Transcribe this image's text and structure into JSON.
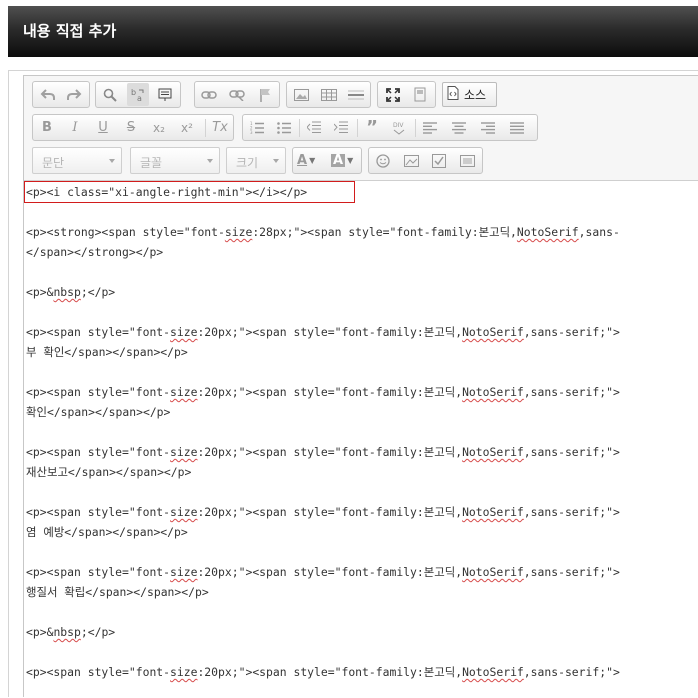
{
  "header": {
    "title": "내용 직접 추가"
  },
  "toolbar": {
    "row1": [
      {
        "name": "undo-button",
        "icon": "undo-icon"
      },
      {
        "name": "redo-button",
        "icon": "redo-icon"
      },
      {
        "name": "find-button",
        "icon": "search-icon"
      },
      {
        "name": "replace-button",
        "icon": "replace-icon"
      },
      {
        "name": "select-all-button",
        "icon": "select-all-icon"
      },
      {
        "name": "link-button",
        "icon": "link-icon"
      },
      {
        "name": "unlink-button",
        "icon": "unlink-icon"
      },
      {
        "name": "anchor-button",
        "icon": "flag-icon"
      },
      {
        "name": "image-button",
        "icon": "image-icon"
      },
      {
        "name": "table-button",
        "icon": "table-icon"
      },
      {
        "name": "horizontal-rule-button",
        "icon": "horizontal-rule-icon"
      },
      {
        "name": "maximize-button",
        "icon": "maximize-icon"
      },
      {
        "name": "show-blocks-button",
        "icon": "show-blocks-icon"
      }
    ],
    "source_label": "소스",
    "row2": [
      {
        "name": "bold-button",
        "glyph": "B"
      },
      {
        "name": "italic-button",
        "glyph": "I"
      },
      {
        "name": "underline-button",
        "glyph": "U"
      },
      {
        "name": "strike-button",
        "glyph": "S"
      },
      {
        "name": "subscript-button",
        "glyph": "x₂"
      },
      {
        "name": "superscript-button",
        "glyph": "x²"
      },
      {
        "name": "remove-format-button",
        "glyph": "Tx"
      }
    ],
    "row2b": [
      {
        "name": "numbered-list-button",
        "icon": "numbered-list-icon"
      },
      {
        "name": "bulleted-list-button",
        "icon": "bulleted-list-icon"
      },
      {
        "name": "outdent-button",
        "icon": "outdent-icon"
      },
      {
        "name": "indent-button",
        "icon": "indent-icon"
      },
      {
        "name": "blockquote-button",
        "icon": "quote-icon"
      },
      {
        "name": "div-button",
        "icon": "div-icon"
      },
      {
        "name": "align-left-button",
        "icon": "align-left-icon"
      },
      {
        "name": "align-center-button",
        "icon": "align-center-icon"
      },
      {
        "name": "align-right-button",
        "icon": "align-right-icon"
      },
      {
        "name": "justify-button",
        "icon": "justify-icon"
      }
    ],
    "format_label": "문단",
    "font_label": "글꼴",
    "size_label": "크기",
    "text_color_glyph": "A",
    "bg_color_glyph": "A",
    "row3b": [
      {
        "name": "emoticon-button",
        "icon": "smiley-icon"
      },
      {
        "name": "flash-button",
        "icon": "flash-icon"
      },
      {
        "name": "checkbox-button",
        "icon": "checkbox-icon"
      },
      {
        "name": "image-insert-button",
        "icon": "image-insert-icon"
      }
    ]
  },
  "code_lines": [
    "<p><i class=\"xi-angle-right-min\"></i></p>",
    "",
    "<p><strong><span style=\"font-size:28px;\"><span style=\"font-family:본고딕,NotoSerif,sans-",
    "</span></strong></p>",
    "",
    "<p>&nbsp;</p>",
    "",
    "<p><span style=\"font-size:20px;\"><span style=\"font-family:본고딕,NotoSerif,sans-serif;\">",
    "부 확인</span></span></p>",
    "",
    "<p><span style=\"font-size:20px;\"><span style=\"font-family:본고딕,NotoSerif,sans-serif;\">",
    "확인</span></span></p>",
    "",
    "<p><span style=\"font-size:20px;\"><span style=\"font-family:본고딕,NotoSerif,sans-serif;\">",
    "재산보고</span></span></p>",
    "",
    "<p><span style=\"font-size:20px;\"><span style=\"font-family:본고딕,NotoSerif,sans-serif;\">",
    "염 예방</span></span></p>",
    "",
    "<p><span style=\"font-size:20px;\"><span style=\"font-family:본고딕,NotoSerif,sans-serif;\">",
    "행질서 확립</span></span></p>",
    "",
    "<p>&nbsp;</p>",
    "",
    "<p><span style=\"font-size:20px;\"><span style=\"font-family:본고딕,NotoSerif,sans-serif;\">"
  ],
  "spellcheck_words": [
    "size",
    "NotoSerif",
    "nbsp"
  ]
}
